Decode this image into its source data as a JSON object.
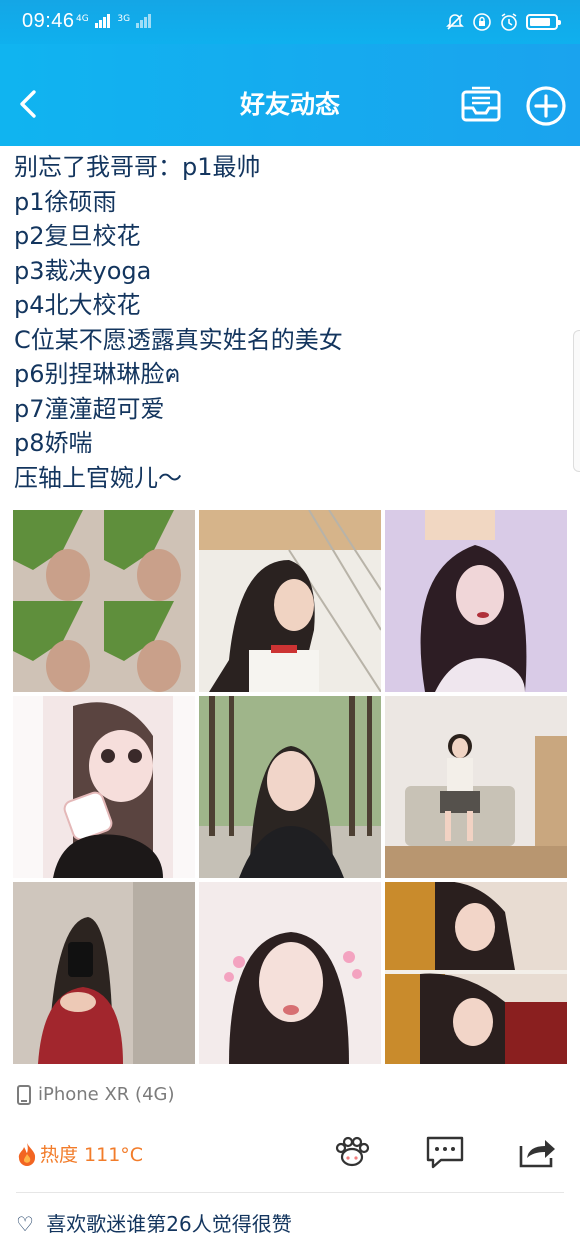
{
  "status_bar": {
    "time": "09:46",
    "net1": "4G",
    "net2": "3G",
    "battery_level": 0.85
  },
  "header": {
    "title": "好友动态"
  },
  "post": {
    "lines": [
      "别忘了我哥哥：p1最帅",
      "p1徐硕雨",
      "p2复旦校花",
      "p3裁决yoga",
      "p4北大校花",
      "C位某不愿透露真实姓名的美女",
      "p6别捏琳琳脸ฅ",
      "p7潼潼超可爱",
      "p8娇喘",
      "压轴上官婉儿〜"
    ],
    "photos": [
      {
        "desc": "collage-leaf-abs",
        "colors": [
          "#6b9a4a",
          "#d8d0c8"
        ]
      },
      {
        "desc": "girl-ponytail-fence",
        "colors": [
          "#c9a27a",
          "#f2efe9"
        ]
      },
      {
        "desc": "girl-long-hair-purple",
        "colors": [
          "#c7b6dd",
          "#3a2b33"
        ]
      },
      {
        "desc": "girl-filter-bottle",
        "colors": [
          "#f1e9ea",
          "#3b2a2c"
        ]
      },
      {
        "desc": "girl-forest",
        "colors": [
          "#7b8e5a",
          "#2c2b2b"
        ]
      },
      {
        "desc": "girl-sofa-room",
        "colors": [
          "#e8e1dc",
          "#b99b7e"
        ]
      },
      {
        "desc": "girl-mirror-red-dress",
        "colors": [
          "#cfc6bd",
          "#a2262d"
        ]
      },
      {
        "desc": "girl-hearts-filter",
        "colors": [
          "#f6eeee",
          "#3a2a2a"
        ]
      },
      {
        "desc": "two-girls-plaid",
        "colors": [
          "#d99b3c",
          "#8a1f1f"
        ]
      }
    ]
  },
  "footer": {
    "device": "iPhone XR (4G)",
    "heat_label": "热度 111°C",
    "like_text": "喜欢歌迷谁第26人觉得很赞"
  },
  "colors": {
    "header_blue": "#10b4f0",
    "text_navy": "#13355e",
    "heat_orange": "#f27c2a"
  }
}
